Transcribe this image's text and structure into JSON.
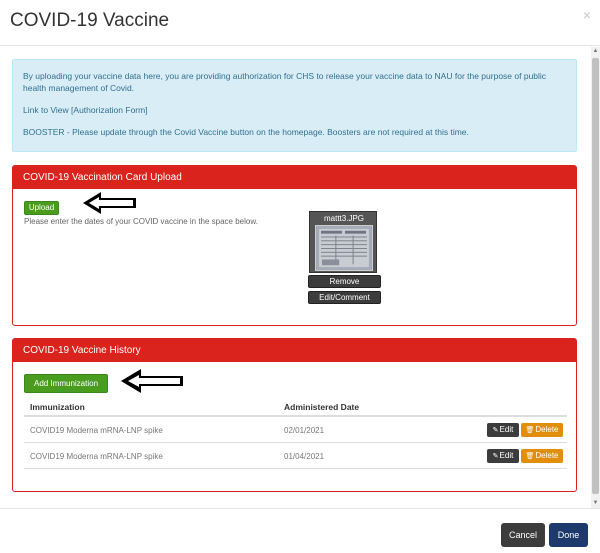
{
  "modal": {
    "title": "COVID-19 Vaccine",
    "close_glyph": "×"
  },
  "info": {
    "line1": "By uploading your vaccine data here, you are providing authorization for CHS to release your vaccine data to NAU for the purpose of public health management of Covid.",
    "link_text": "Link to View [Authorization Form]",
    "booster": "BOOSTER - Please update through the Covid Vaccine button on the homepage. Boosters are not required at this time."
  },
  "upload_panel": {
    "title": "COVID-19 Vaccination Card Upload",
    "upload_label": "Upload",
    "hint": "Please enter the dates of your COVID vaccine in the space below.",
    "file_name": "mattt3.JPG",
    "remove_label": "Remove",
    "edit_comment_label": "Edit/Comment"
  },
  "history_panel": {
    "title": "COVID-19 Vaccine History",
    "add_label": "Add Immunization",
    "columns": [
      "Immunization",
      "Administered Date"
    ],
    "rows": [
      {
        "immunization": "COVID19 Moderna mRNA-LNP spike",
        "date": "02/01/2021"
      },
      {
        "immunization": "COVID19 Moderna mRNA-LNP spike",
        "date": "01/04/2021"
      }
    ],
    "edit_label": "Edit",
    "delete_label": "Delete"
  },
  "footer": {
    "cancel_label": "Cancel",
    "done_label": "Done"
  },
  "icons": {
    "pencil": "pencil-icon",
    "trash": "trash-icon",
    "arrow": "left-arrow-icon"
  },
  "colors": {
    "panel_red": "#d9231c",
    "info_bg": "#d9edf7",
    "green": "#4a9c1f",
    "done_navy": "#1e3a6d",
    "delete_orange": "#e08e0b"
  }
}
